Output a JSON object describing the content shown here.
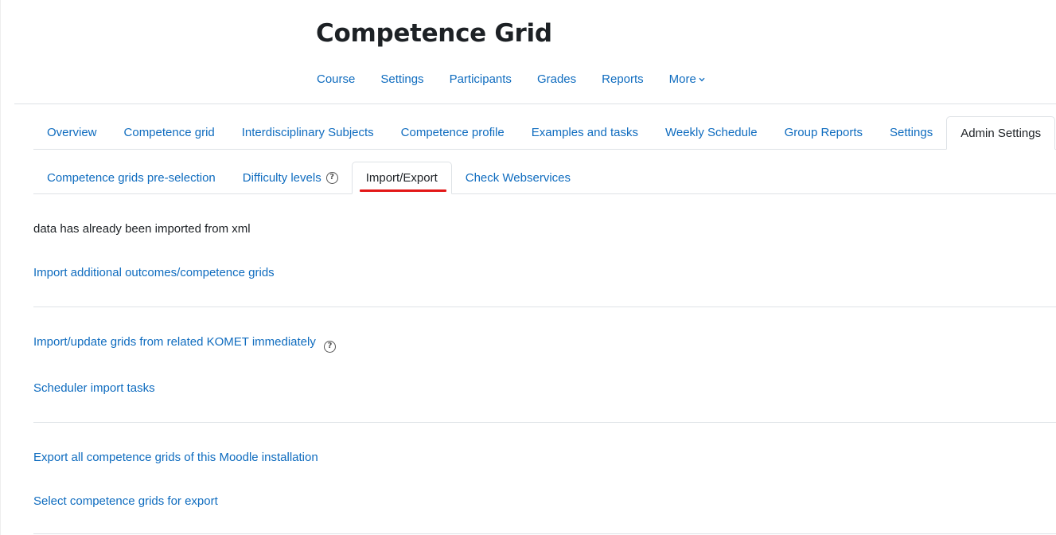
{
  "header": {
    "title": "Competence Grid",
    "nav": [
      "Course",
      "Settings",
      "Participants",
      "Grades",
      "Reports"
    ],
    "more_label": "More",
    "more_icon": "chevron-down-icon"
  },
  "tabs": {
    "primary": [
      "Overview",
      "Competence grid",
      "Interdisciplinary Subjects",
      "Competence profile",
      "Examples and tasks",
      "Weekly Schedule",
      "Group Reports",
      "Settings",
      "Admin Settings"
    ],
    "primary_active": "Admin Settings",
    "secondary": [
      "Competence grids pre-selection",
      "Difficulty levels",
      "Import/Export",
      "Check Webservices"
    ],
    "secondary_active": "Import/Export",
    "help_icon": "question-circle-icon",
    "accent_color": "#e31717"
  },
  "main": {
    "status_text": "data has already been imported from xml",
    "import_additional": "Import additional outcomes/competence grids",
    "import_komet": "Import/update grids from related KOMET immediately",
    "scheduler": "Scheduler import tasks",
    "export_all": "Export all competence grids of this Moodle installation",
    "select_export": "Select competence grids for export"
  },
  "colors": {
    "link": "#0f6cbf",
    "text": "#1d2125",
    "border": "#dee2e6"
  }
}
